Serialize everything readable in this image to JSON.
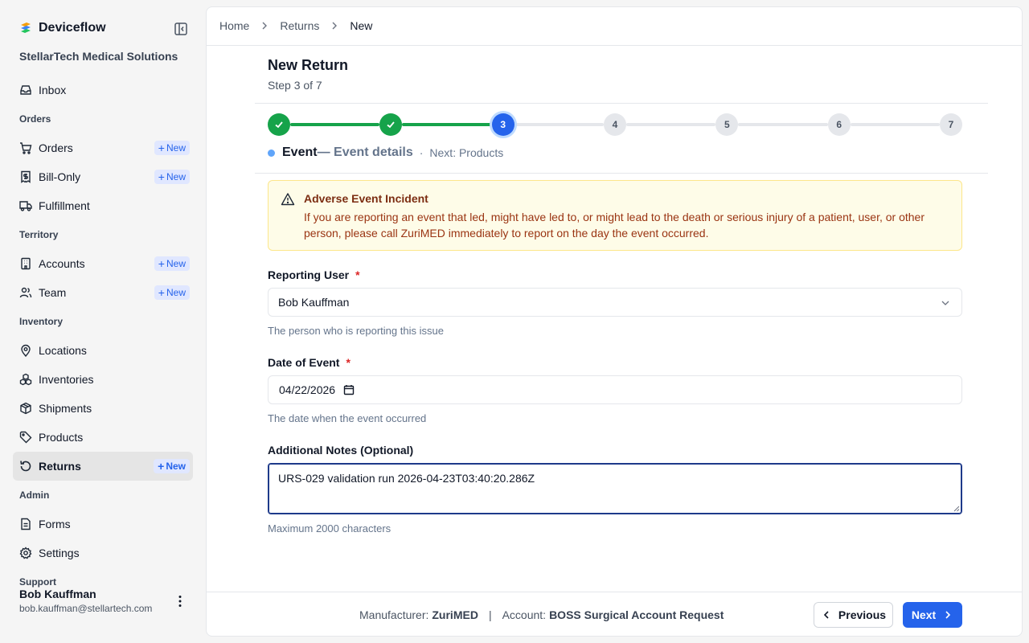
{
  "sidebar": {
    "brand": "Deviceflow",
    "org": "StellarTech Medical Solutions",
    "new_label": "New",
    "items": {
      "inbox": "Inbox",
      "orders_section": "Orders",
      "orders": "Orders",
      "bill_only": "Bill-Only",
      "fulfillment": "Fulfillment",
      "territory_section": "Territory",
      "accounts": "Accounts",
      "team": "Team",
      "inventory_section": "Inventory",
      "locations": "Locations",
      "inventories": "Inventories",
      "shipments": "Shipments",
      "products": "Products",
      "returns": "Returns",
      "admin_section": "Admin",
      "forms": "Forms",
      "settings": "Settings",
      "support_section": "Support"
    },
    "user": {
      "name": "Bob Kauffman",
      "email": "bob.kauffman@stellartech.com"
    }
  },
  "breadcrumb": {
    "home": "Home",
    "returns": "Returns",
    "current": "New"
  },
  "page": {
    "title": "New Return",
    "step": "Step 3 of 7"
  },
  "stepper": {
    "total": 7,
    "current": 3,
    "labels": [
      "1",
      "2",
      "3",
      "4",
      "5",
      "6",
      "7"
    ],
    "caption_name": "Event",
    "caption_desc": "— Event details",
    "caption_sep": "·",
    "caption_next": "Next: Products"
  },
  "alert": {
    "title": "Adverse Event Incident",
    "body": "If you are reporting an event that led, might have led to, or might lead to the death or serious injury of a patient, user, or other person, please call ZuriMED immediately to report on the day the event occurred."
  },
  "form": {
    "required_mark": "*",
    "reporting_user": {
      "label": "Reporting User",
      "value": "Bob Kauffman",
      "help": "The person who is reporting this issue"
    },
    "date_of_event": {
      "label": "Date of Event",
      "value": "04/22/2026",
      "help": "The date when the event occurred"
    },
    "notes": {
      "label": "Additional Notes (Optional)",
      "value": "URS-029 validation run 2026-04-23T03:40:20.286Z",
      "help": "Maximum 2000 characters"
    }
  },
  "footer": {
    "manufacturer_label": "Manufacturer:",
    "manufacturer_value": "ZuriMED",
    "pipe": "|",
    "account_label": "Account:",
    "account_value": "BOSS Surgical Account Request",
    "previous": "Previous",
    "next": "Next"
  },
  "colors": {
    "accent": "#2563eb",
    "done": "#16a34a",
    "alert_bg": "#fefce8",
    "required": "#dc2626"
  }
}
